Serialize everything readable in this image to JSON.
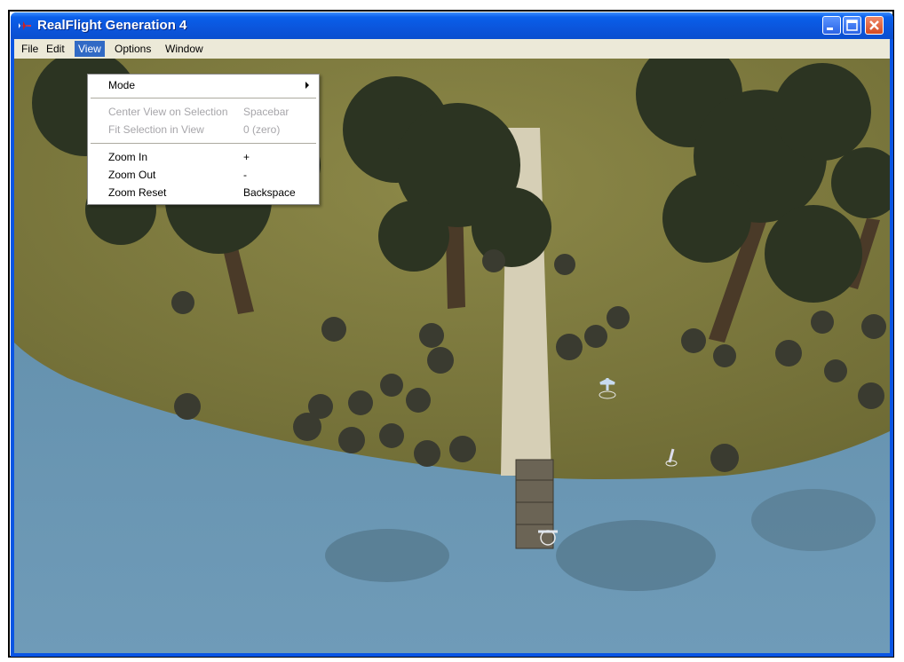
{
  "window": {
    "title": "RealFlight Generation 4",
    "app_icon": "airplane-icon",
    "controls": [
      "minimize-icon",
      "maximize-icon",
      "close-icon"
    ],
    "title_bar_color": "#0a55e3"
  },
  "menubar": {
    "items": [
      {
        "label": "File"
      },
      {
        "label": "Edit"
      },
      {
        "label": "View",
        "active": true
      },
      {
        "label": "Options"
      },
      {
        "label": "Window"
      }
    ]
  },
  "view_menu": {
    "items": [
      {
        "label": "Mode",
        "shortcut": "",
        "submenu": true,
        "enabled": true
      },
      {
        "label": "Center View on Selection",
        "shortcut": "Spacebar",
        "enabled": false
      },
      {
        "label": "Fit Selection in View",
        "shortcut": "0 (zero)",
        "enabled": false
      },
      {
        "label": "Zoom In",
        "shortcut": "+",
        "enabled": true
      },
      {
        "label": "Zoom Out",
        "shortcut": "-",
        "enabled": true
      },
      {
        "label": "Zoom Reset",
        "shortcut": "Backspace",
        "enabled": true
      }
    ]
  },
  "colors": {
    "menu_highlight": "#316ac5",
    "grass": "#7e7a3f",
    "water": "#5f8fad",
    "runway": "#d9d3bd",
    "tree": "#2a3220"
  }
}
